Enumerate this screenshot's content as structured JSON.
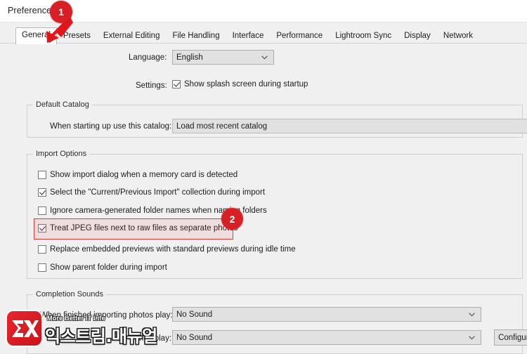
{
  "window": {
    "title": "Preferences"
  },
  "tabs": [
    {
      "label": "General",
      "active": true
    },
    {
      "label": "Presets",
      "active": false
    },
    {
      "label": "External Editing",
      "active": false
    },
    {
      "label": "File Handling",
      "active": false
    },
    {
      "label": "Interface",
      "active": false
    },
    {
      "label": "Performance",
      "active": false
    },
    {
      "label": "Lightroom Sync",
      "active": false
    },
    {
      "label": "Display",
      "active": false
    },
    {
      "label": "Network",
      "active": false
    }
  ],
  "general": {
    "language_label": "Language:",
    "language_value": "English",
    "settings_label": "Settings:",
    "splash_checkbox": {
      "label": "Show splash screen during startup",
      "checked": true
    }
  },
  "default_catalog": {
    "group_title": "Default Catalog",
    "startup_label": "When starting up use this catalog:",
    "startup_value": "Load most recent catalog"
  },
  "import_options": {
    "group_title": "Import Options",
    "items": [
      {
        "label": "Show import dialog when a memory card is detected",
        "checked": false
      },
      {
        "label": "Select the \"Current/Previous Import\" collection during import",
        "checked": true
      },
      {
        "label": "Ignore camera-generated folder names when naming folders",
        "checked": false
      },
      {
        "label": "Treat JPEG files next to raw files as separate photos",
        "checked": true
      },
      {
        "label": "Replace embedded previews with standard previews during idle time",
        "checked": false
      },
      {
        "label": "Show parent folder during import",
        "checked": false
      }
    ]
  },
  "completion_sounds": {
    "group_title": "Completion Sounds",
    "import_label": "When finished importing photos play:",
    "import_value": "No Sound",
    "tether_label": "nes play:",
    "tether_value": "No Sound",
    "configure_button": "Configure"
  },
  "annotations": {
    "badges": [
      {
        "number": "1",
        "target": "general-tab"
      },
      {
        "number": "2",
        "target": "treat-jpeg-checkbox"
      }
    ],
    "accent_color": "#d81f26",
    "highlight_border_color": "#e03a3a"
  },
  "watermark": {
    "tagline": "More Better IT Life",
    "name": "익스트림.매뉴얼"
  }
}
